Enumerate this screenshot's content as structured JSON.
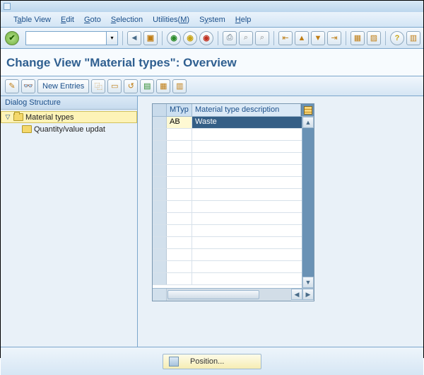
{
  "menubar": {
    "items": [
      {
        "pre": "T",
        "u": "a",
        "post": "ble View"
      },
      {
        "pre": "",
        "u": "E",
        "post": "dit"
      },
      {
        "pre": "",
        "u": "G",
        "post": "oto"
      },
      {
        "pre": "",
        "u": "S",
        "post": "election"
      },
      {
        "pre": "Utilities(",
        "u": "M",
        "post": ")"
      },
      {
        "pre": "S",
        "u": "y",
        "post": "stem"
      },
      {
        "pre": "",
        "u": "H",
        "post": "elp"
      }
    ]
  },
  "page_title": "Change View \"Material types\": Overview",
  "toolbar2": {
    "new_entries_label": "New Entries"
  },
  "dialog_structure": {
    "title": "Dialog Structure",
    "nodes": [
      {
        "label": "Material types",
        "selected": true,
        "expanded": true
      },
      {
        "label": "Quantity/value updat",
        "selected": false,
        "expanded": false
      }
    ]
  },
  "table": {
    "columns": {
      "mtyp": "MTyp",
      "desc": "Material type description"
    },
    "rows": [
      {
        "mtyp": "AB",
        "desc": "Waste",
        "selected": true
      }
    ],
    "empty_row_count": 13
  },
  "footer": {
    "position_label": "Position..."
  },
  "icons": {
    "ok": "ok-icon",
    "save": "save-icon",
    "back": "back-icon",
    "exit": "exit-icon",
    "cancel": "cancel-icon",
    "print": "print-icon",
    "find": "find-icon",
    "find_next": "find-next-icon",
    "first": "first-page-icon",
    "prev": "prev-page-icon",
    "next": "next-page-icon",
    "last": "last-page-icon",
    "new_session": "new-session-icon",
    "shortcut": "shortcut-icon",
    "help": "help-icon",
    "layout": "layout-icon",
    "detail": "detail-icon",
    "copy": "copy-as-icon",
    "delete": "delete-icon",
    "undo": "undo-icon",
    "select_all": "select-all-icon",
    "deselect_all": "deselect-all-icon",
    "pencil": "change-icon",
    "glasses": "display-icon",
    "configure": "configure-columns-icon"
  }
}
